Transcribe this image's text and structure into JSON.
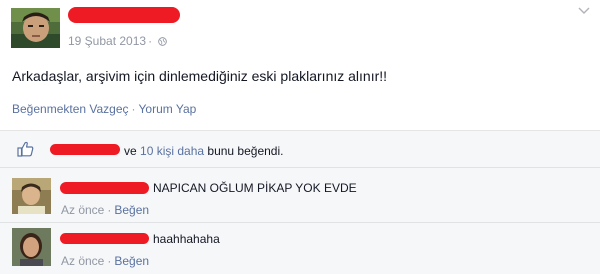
{
  "post": {
    "date": "19 Şubat 2013",
    "meta_separator": "·",
    "text": "Arkadaşlar, arşivim için dinlemediğiniz eski plaklarınız alınır!!",
    "actions": {
      "unlike": "Beğenmekten Vazgeç",
      "separator": "·",
      "comment": "Yorum Yap"
    }
  },
  "likes": {
    "connector": " ve ",
    "count_link": "10 kişi daha",
    "suffix": " bunu beğendi."
  },
  "comments": [
    {
      "text": "NAPICAN OĞLUM PİKAP YOK EVDE",
      "time": "Az önce",
      "separator": "·",
      "like": "Beğen"
    },
    {
      "text": "haahhahaha",
      "time": "Az önce",
      "separator": "·",
      "like": "Beğen"
    }
  ],
  "colors": {
    "link": "#5a72a0",
    "redaction": "#ee1b24",
    "meta": "#9197a3",
    "panel": "#f6f7f9"
  },
  "icons": [
    "globe-icon",
    "chevron-down-icon",
    "thumbs-up-icon"
  ]
}
